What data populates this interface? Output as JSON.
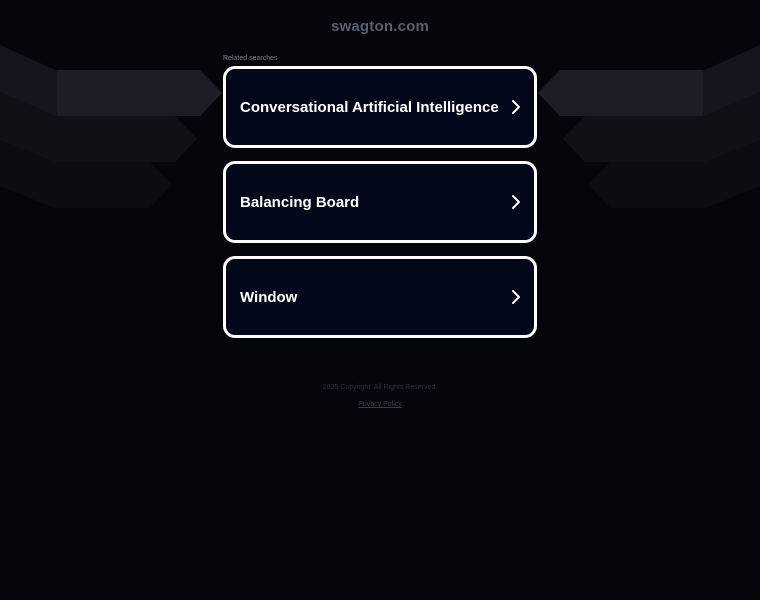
{
  "header": {
    "domain": "swagton.com"
  },
  "related": {
    "label": "Related searches",
    "items": [
      {
        "label": "Conversational Artificial Intelligence"
      },
      {
        "label": "Balancing Board"
      },
      {
        "label": "Window"
      }
    ]
  },
  "footer": {
    "copyright": "2025 Copyright. All Rights Reserved.",
    "privacy": "Privacy Policy"
  },
  "colors": {
    "background": "#05060b",
    "card_background": "#03081a",
    "card_border": "#ffffff"
  },
  "icons": {
    "card_arrow": "chevron-right-icon"
  }
}
